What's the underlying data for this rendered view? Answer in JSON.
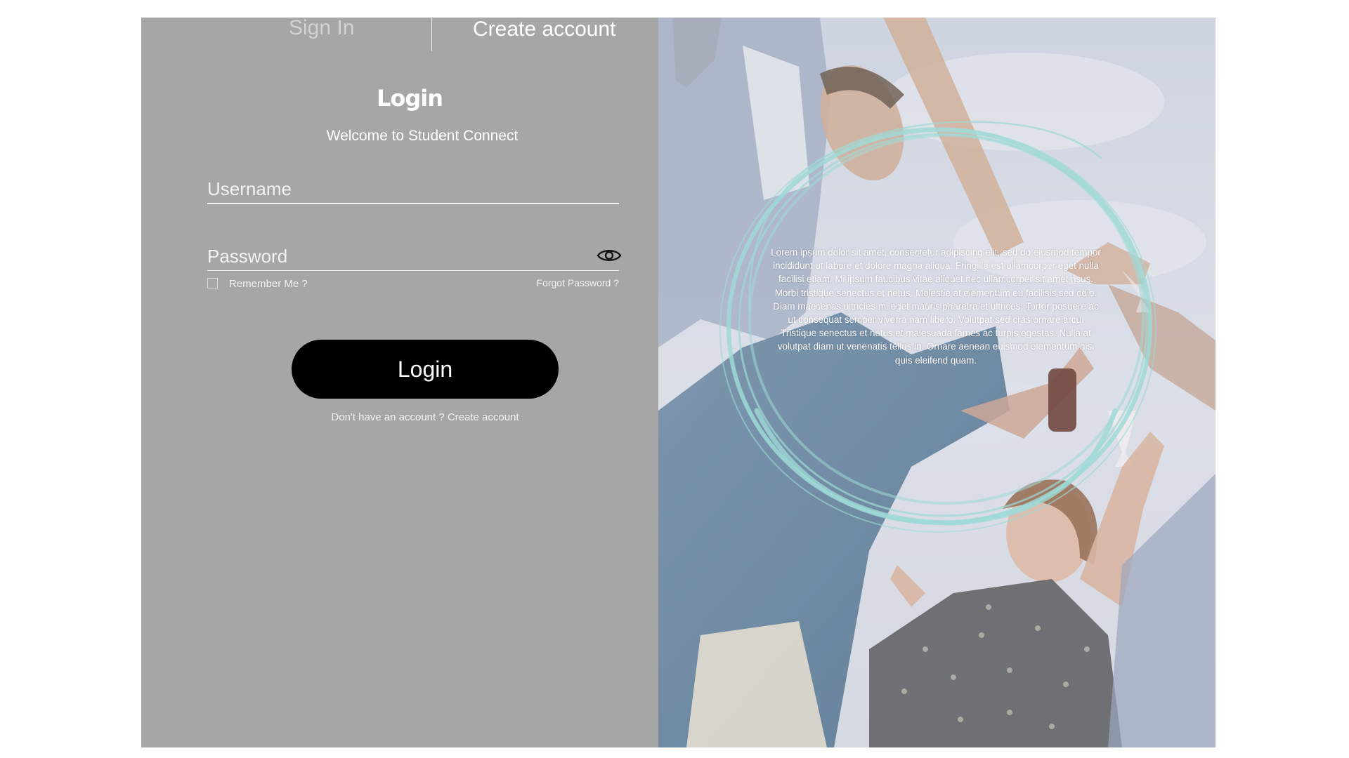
{
  "tabs": {
    "sign_in": "Sign In",
    "create_account": "Create account"
  },
  "login": {
    "title": "Login",
    "welcome": "Welcome to Student Connect",
    "username_placeholder": "Username",
    "password_placeholder": "Password",
    "remember_me": "Remember Me ?",
    "forgot_password": "Forgot Password ?",
    "button_label": "Login",
    "signup_prompt": "Don't have an account ? Create account"
  },
  "promo": {
    "text": "Lorem ipsum dolor sit amet, consectetur adipiscing elit, sed do eiusmod tempor incididunt ut labore et dolore magna aliqua. Fringilla est ullamcorper eget nulla facilisi etiam. Mi ipsum faucibus vitae aliquet nec ullamcorper sit amet risus. Morbi tristique senectus et netus. Molestie at elementum eu facilisis sed odio. Diam maecenas ultricies mi eget mauris pharetra et ultrices. Tortor posuere ac ut consequat semper viverra nam libero. Volutpat sed cras ornare arcu. Tristique senectus et netus et malesuada fames ac turpis egestas. Nulla at volutpat diam ut venenatis tellus in. Ornare aenean euismod elementum nisi quis eleifend quam."
  },
  "colors": {
    "panel_gray": "#a6a6a6",
    "button_black": "#000000",
    "ring_teal": "#8fd3cf",
    "sky": "#c9d1de"
  },
  "icons": {
    "password_toggle": "eye-icon"
  }
}
